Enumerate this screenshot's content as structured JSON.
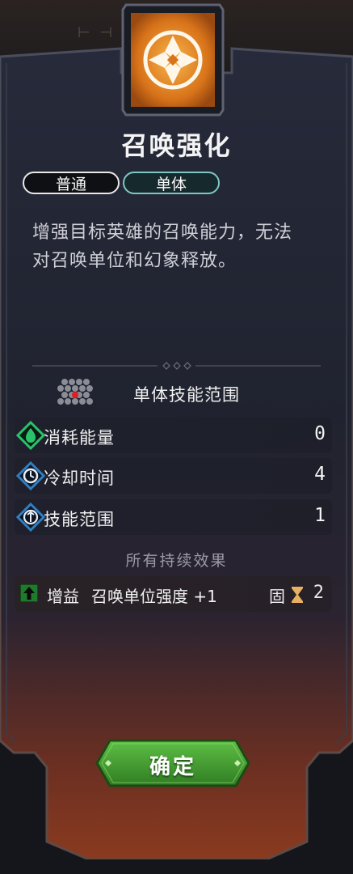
{
  "skill": {
    "title": "召唤强化",
    "tags": [
      "普通",
      "单体"
    ],
    "description": "增强目标英雄的召唤能力，无法对召唤单位和幻象释放。",
    "range_label": "单体技能范围"
  },
  "stats": [
    {
      "label": "消耗能量",
      "value": "0",
      "icon": "energy-icon",
      "color": "#27c46a"
    },
    {
      "label": "冷却时间",
      "value": "4",
      "icon": "cooldown-icon",
      "color": "#2e7fc4"
    },
    {
      "label": "技能范围",
      "value": "1",
      "icon": "range-icon",
      "color": "#2e7fc4"
    }
  ],
  "effects": {
    "title": "所有持续效果",
    "items": [
      {
        "type": "增益",
        "desc": "召唤单位强度 +1",
        "fixed": "固",
        "duration": "2"
      }
    ]
  },
  "confirm_label": "确定",
  "colors": {
    "accent_orange": "#e88a1a",
    "confirm_green": "#3f9a2f",
    "tag_single_border": "#7ec8c4"
  }
}
